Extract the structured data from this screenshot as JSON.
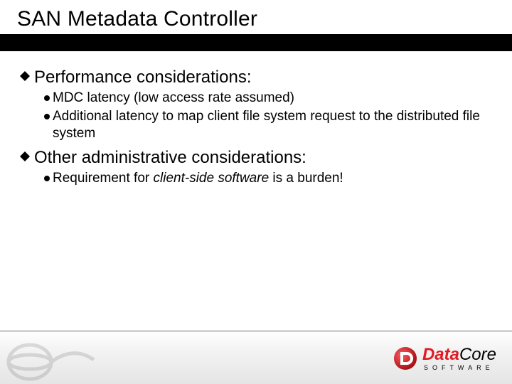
{
  "title": "SAN Metadata Controller",
  "sections": [
    {
      "heading": "Performance considerations:",
      "items": [
        {
          "text": "MDC latency (low access rate assumed)"
        },
        {
          "text": "Additional latency to map client file system request to the distributed file system"
        }
      ]
    },
    {
      "heading": "Other administrative considerations:",
      "items": [
        {
          "prefix": "Requirement for ",
          "emph": "client-side software",
          "suffix": " is a burden!"
        }
      ]
    }
  ],
  "logo": {
    "part1": "Data",
    "part2": "Core",
    "sub": "SOFTWARE"
  }
}
